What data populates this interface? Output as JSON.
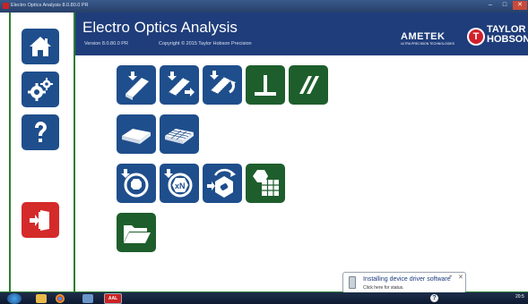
{
  "window": {
    "title": "Electro Optics Analysis 8.0.80.0 PR",
    "minimize_glyph": "–",
    "maximize_glyph": "□",
    "close_glyph": "✕"
  },
  "header": {
    "title": "Electro Optics Analysis",
    "version": "Version  8.0.80.0  PR",
    "copyright": "Copyright ©  2015  Taylor Hobson Precision",
    "brand_ametek": "AMETEK",
    "brand_ametek_sub": "ULTRA PRECISION TECHNOLOGIES",
    "brand_th_mark": "T",
    "brand_th_line1": "TAYLOR",
    "brand_th_line2": "HOBSON",
    "colors": {
      "header_bg": "#1f3d7a",
      "accent_red": "#d21f2b"
    }
  },
  "sidebar": {
    "items": [
      {
        "name": "home",
        "icon": "home-icon"
      },
      {
        "name": "settings",
        "icon": "gears-icon"
      },
      {
        "name": "help",
        "icon": "question-icon"
      },
      {
        "name": "exit",
        "icon": "exit-door-icon"
      }
    ]
  },
  "tools": {
    "colors": {
      "blue": "#1f4e8c",
      "green": "#1e5e2c"
    },
    "rows": [
      [
        "prism-measure-icon",
        "prism-flip-icon",
        "prism-rotate-icon",
        "perpendicularity-icon",
        "parallelism-icon"
      ],
      [
        "window-single-icon",
        "window-grid-icon"
      ],
      [
        "rotate-part-icon",
        "multi-facet-icon",
        "turntable-icon",
        "polygon-table-icon"
      ],
      [
        "open-folder-icon"
      ]
    ]
  },
  "notification": {
    "title": "Installing device driver software",
    "subtitle": "Click here for status.",
    "pin_glyph": "⌖",
    "close_glyph": "✕"
  },
  "taskbar": {
    "app_label": "AAL",
    "help_glyph": "?",
    "clock": "20:5"
  }
}
